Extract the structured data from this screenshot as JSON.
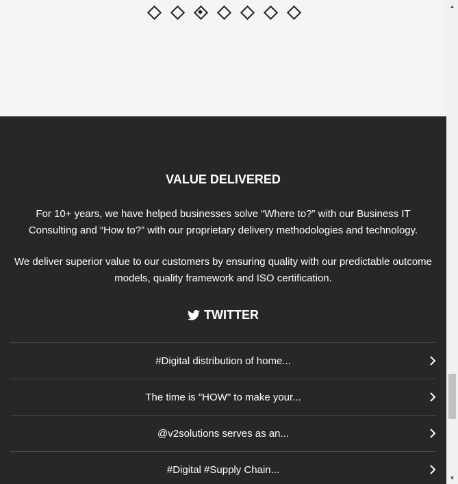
{
  "carousel": {
    "dot_count": 7,
    "active_index": 2
  },
  "value_section": {
    "title": "VALUE DELIVERED",
    "paragraph1": "For 10+ years, we have helped businesses solve “Where to?” with our Business IT Consulting and “How to?” with our proprietary delivery methodologies and technology.",
    "paragraph2": "We deliver superior value to our customers by ensuring quality with our predictable outcome models, quality framework and ISO certification."
  },
  "twitter": {
    "heading": "TWITTER",
    "icon": "twitter-bird-icon",
    "items": [
      {
        "text": "#Digital distribution of home..."
      },
      {
        "text": "The time is \"HOW\" to make your..."
      },
      {
        "text": "@v2solutions serves as an..."
      },
      {
        "text": "#Digital #Supply Chain..."
      }
    ]
  },
  "colors": {
    "top_background": "#f3f5f4",
    "dark_background": "#272727",
    "text": "#ffffff",
    "divider": "#4a4a4a"
  }
}
